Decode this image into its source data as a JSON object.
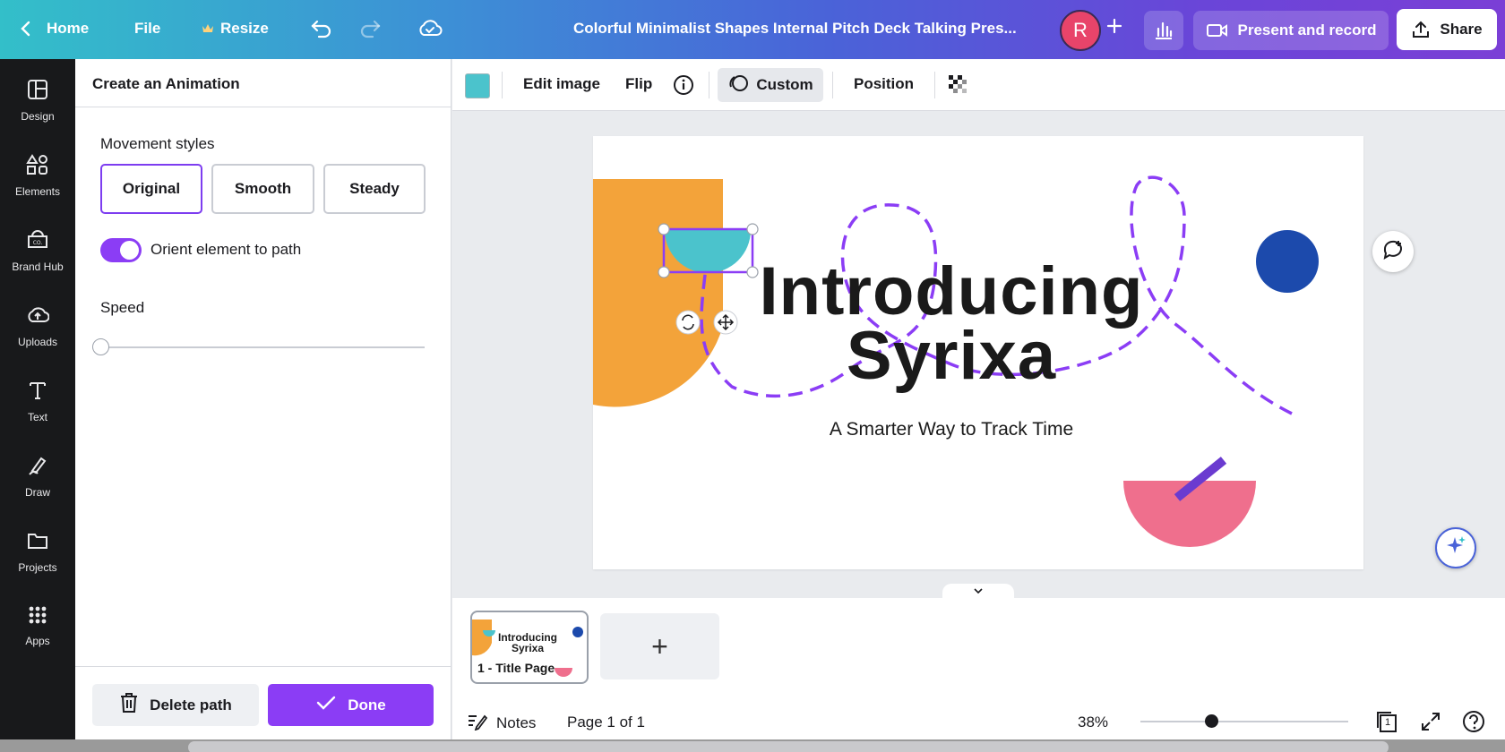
{
  "topbar": {
    "home_label": "Home",
    "file_label": "File",
    "resize_label": "Resize",
    "doc_title": "Colorful Minimalist Shapes Internal Pitch Deck Talking Pres...",
    "avatar_initial": "R",
    "present_label": "Present and record",
    "share_label": "Share",
    "gradient_colors": [
      "#33bfc9",
      "#4a63d8",
      "#7b3fd6"
    ]
  },
  "rail": {
    "items": [
      {
        "label": "Design",
        "icon": "layout-icon"
      },
      {
        "label": "Elements",
        "icon": "shapes-icon"
      },
      {
        "label": "Brand Hub",
        "icon": "brand-icon"
      },
      {
        "label": "Uploads",
        "icon": "cloud-upload-icon"
      },
      {
        "label": "Text",
        "icon": "text-icon"
      },
      {
        "label": "Draw",
        "icon": "pen-icon"
      },
      {
        "label": "Projects",
        "icon": "folder-icon"
      },
      {
        "label": "Apps",
        "icon": "grid-icon"
      }
    ]
  },
  "panel": {
    "title": "Create an Animation",
    "movement_label": "Movement styles",
    "styles": [
      "Original",
      "Smooth",
      "Steady"
    ],
    "selected_style": "Original",
    "orient_label": "Orient element to path",
    "orient_on": true,
    "speed_label": "Speed",
    "speed_value": 0,
    "delete_label": "Delete path",
    "done_label": "Done",
    "accent": "#8b3df5"
  },
  "toolbar": {
    "swatch_color": "#4bc3cc",
    "edit_image_label": "Edit image",
    "flip_label": "Flip",
    "custom_label": "Custom",
    "position_label": "Position"
  },
  "slide": {
    "title_line1": "Introducing",
    "title_line2": "Syrixa",
    "subtitle": "A Smarter Way to Track Time",
    "colors": {
      "orange": "#f3a33a",
      "teal": "#4bc3cc",
      "blue": "#1c4aac",
      "pink": "#ef6f8d",
      "path": "#8b3df5"
    }
  },
  "pages": {
    "thumb_label": "1 - Title Page",
    "thumb_title_line1": "Introducing",
    "thumb_title_line2": "Syrixa",
    "add_label": "+"
  },
  "status": {
    "notes_label": "Notes",
    "page_label": "Page 1 of 1",
    "zoom_label": "38%",
    "zoom_value": 38,
    "page_count": "1"
  }
}
